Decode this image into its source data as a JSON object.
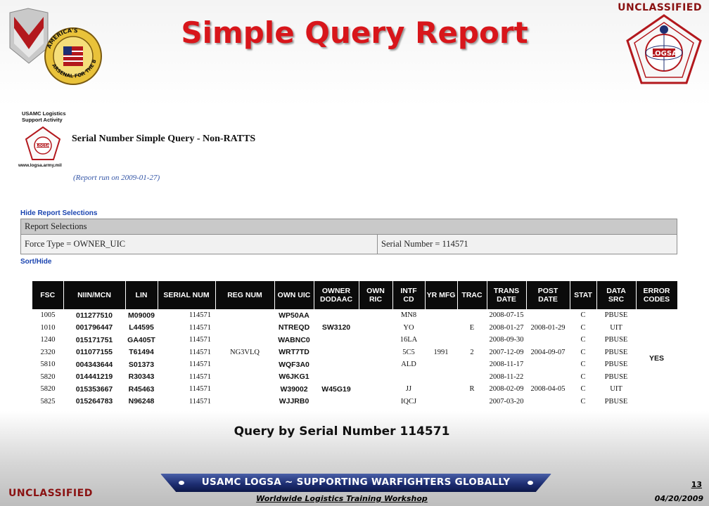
{
  "classification_top": "UNCLASSIFIED",
  "classification_bottom": "UNCLASSIFIED",
  "slide_title": "Simple Query Report",
  "logos": {
    "left_seal_text": "AMERICA'S ARSENAL FOR THE BRAVE",
    "right_seal_text": "LOGSA"
  },
  "report": {
    "org_line1": "USAMC Logistics",
    "org_line2": "Support Activity",
    "logo_text": "LOGSA",
    "website": "www.logsa.army.mil",
    "title": "Serial Number Simple Query - Non-RATTS",
    "run_note": "(Report run on 2009-01-27)",
    "hide_selections_link": "Hide Report Selections",
    "selections_header": "Report Selections",
    "selection_force_type": "Force Type = OWNER_UIC",
    "selection_serial": "Serial Number = 114571",
    "sort_hide_link": "Sort/Hide"
  },
  "table": {
    "headers": {
      "fsc": "FSC",
      "niin": "NIIN/MCN",
      "lin": "LIN",
      "serial": "SERIAL NUM",
      "reg": "REG NUM",
      "own_uic": "OWN UIC",
      "owner_dodaac": "OWNER DODAAC",
      "own_ric": "OWN RIC",
      "intf_cd": "INTF CD",
      "yr_mfg": "YR MFG",
      "trac": "TRAC",
      "trans_date": "TRANS DATE",
      "post_date": "POST DATE",
      "stat": "STAT",
      "data_src": "DATA SRC",
      "error_codes": "ERROR CODES"
    },
    "rows": [
      {
        "fsc": "1005",
        "niin": "011277510",
        "lin": "M09009",
        "serial": "114571",
        "reg": "",
        "own_uic": "WP50AA",
        "owner_dodaac": "",
        "own_ric": "",
        "intf_cd": "MN8",
        "yr_mfg": "",
        "trac": "",
        "trans_date": "2008-07-15",
        "post_date": "",
        "stat": "C",
        "data_src": "PBUSE"
      },
      {
        "fsc": "1010",
        "niin": "001796447",
        "lin": "L44595",
        "serial": "114571",
        "reg": "",
        "own_uic": "NTREQD",
        "owner_dodaac": "SW3120",
        "own_ric": "",
        "intf_cd": "YO",
        "yr_mfg": "",
        "trac": "E",
        "trans_date": "2008-01-27",
        "post_date": "2008-01-29",
        "stat": "C",
        "data_src": "UIT"
      },
      {
        "fsc": "1240",
        "niin": "015171751",
        "lin": "GA405T",
        "serial": "114571",
        "reg": "",
        "own_uic": "WABNC0",
        "owner_dodaac": "",
        "own_ric": "",
        "intf_cd": "16LA",
        "yr_mfg": "",
        "trac": "",
        "trans_date": "2008-09-30",
        "post_date": "",
        "stat": "C",
        "data_src": "PBUSE"
      },
      {
        "fsc": "2320",
        "niin": "011077155",
        "lin": "T61494",
        "serial": "114571",
        "reg": "NG3VLQ",
        "own_uic": "WRT7TD",
        "owner_dodaac": "",
        "own_ric": "",
        "intf_cd": "5C5",
        "yr_mfg": "1991",
        "trac": "2",
        "trans_date": "2007-12-09",
        "post_date": "2004-09-07",
        "stat": "C",
        "data_src": "PBUSE"
      },
      {
        "fsc": "5810",
        "niin": "004343644",
        "lin": "S01373",
        "serial": "114571",
        "reg": "",
        "own_uic": "WQF3A0",
        "owner_dodaac": "",
        "own_ric": "",
        "intf_cd": "ALD",
        "yr_mfg": "",
        "trac": "",
        "trans_date": "2008-11-17",
        "post_date": "",
        "stat": "C",
        "data_src": "PBUSE"
      },
      {
        "fsc": "5820",
        "niin": "014441219",
        "lin": "R30343",
        "serial": "114571",
        "reg": "",
        "own_uic": "W6JKG1",
        "owner_dodaac": "",
        "own_ric": "",
        "intf_cd": "",
        "yr_mfg": "",
        "trac": "",
        "trans_date": "2008-11-22",
        "post_date": "",
        "stat": "C",
        "data_src": "PBUSE"
      },
      {
        "fsc": "5820",
        "niin": "015353667",
        "lin": "R45463",
        "serial": "114571",
        "reg": "",
        "own_uic": "W39002",
        "owner_dodaac": "W45G19",
        "own_ric": "",
        "intf_cd": "JJ",
        "yr_mfg": "",
        "trac": "R",
        "trans_date": "2008-02-09",
        "post_date": "2008-04-05",
        "stat": "C",
        "data_src": "UIT"
      },
      {
        "fsc": "5825",
        "niin": "015264783",
        "lin": "N96248",
        "serial": "114571",
        "reg": "",
        "own_uic": "WJJRB0",
        "owner_dodaac": "",
        "own_ric": "",
        "intf_cd": "IQCJ",
        "yr_mfg": "",
        "trac": "",
        "trans_date": "2007-03-20",
        "post_date": "",
        "stat": "C",
        "data_src": "PBUSE"
      }
    ],
    "error_codes_value": "YES"
  },
  "caption": "Query by Serial Number 114571",
  "footer": {
    "banner": "USAMC LOGSA ~ SUPPORTING WARFIGHTERS GLOBALLY",
    "workshop": "Worldwide Logistics Training Workshop",
    "page_number": "13",
    "date": "04/20/2009"
  },
  "colors": {
    "title_red": "#d8161b",
    "classification": "#8a1212",
    "link_blue": "#1a44b0",
    "header_black": "#0b0b0b",
    "banner_blue": "#1e2f73"
  },
  "icons": {
    "left_logo": "amc-shield-and-arsenal-seal-icon",
    "right_logo": "logsa-pentagon-seal-icon",
    "report_logo": "logsa-small-pentagon-icon"
  }
}
